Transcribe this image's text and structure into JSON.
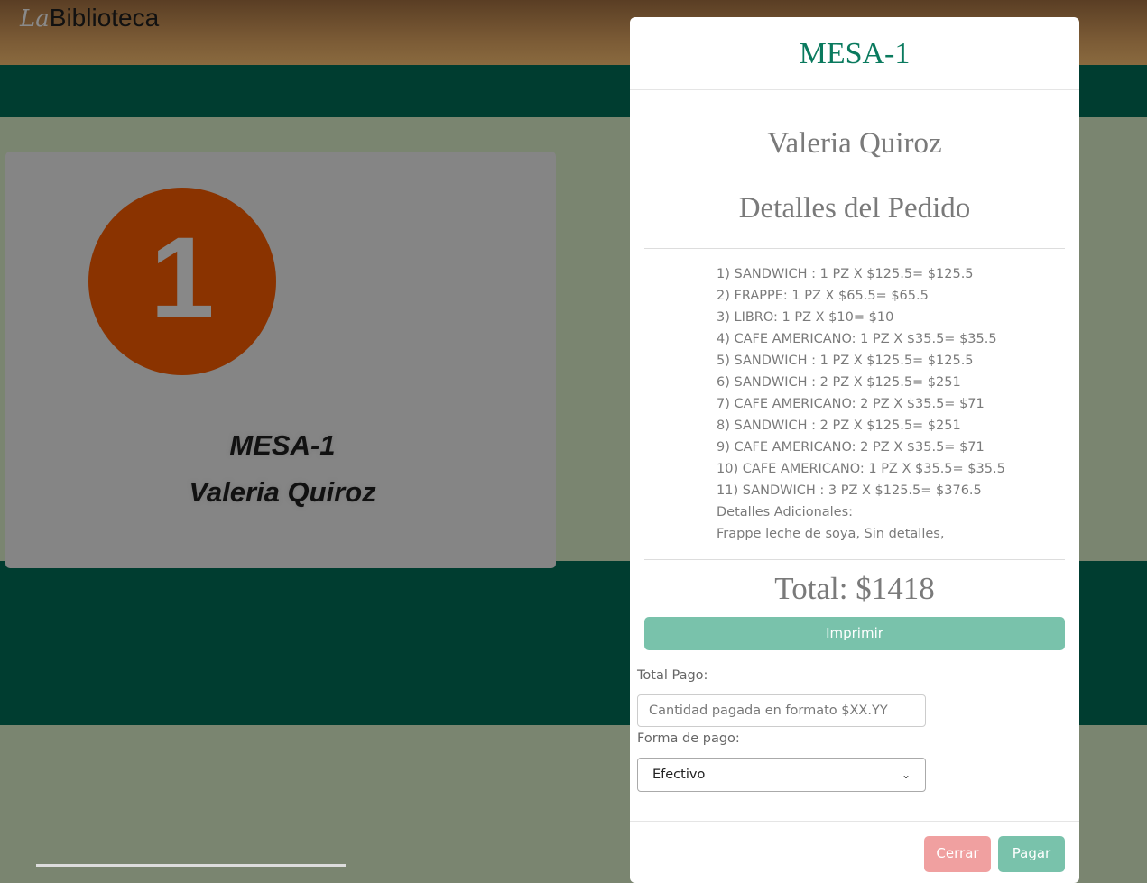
{
  "header": {
    "logo_prefix": "La",
    "logo_main": "Biblioteca"
  },
  "card": {
    "number": "1",
    "title": "MESA-1",
    "client": "Valeria Quiroz"
  },
  "modal": {
    "title": "MESA-1",
    "client": "Valeria Quiroz",
    "details_title": "Detalles del Pedido",
    "items": [
      "1) SANDWICH : 1 PZ X $125.5= $125.5",
      "2) FRAPPE: 1 PZ X $65.5= $65.5",
      "3) LIBRO: 1 PZ X $10= $10",
      "4) CAFE AMERICANO: 1 PZ X $35.5= $35.5",
      "5) SANDWICH : 1 PZ X $125.5= $125.5",
      "6) SANDWICH : 2 PZ X $125.5= $251",
      "7) CAFE AMERICANO: 2 PZ X $35.5= $71",
      "8) SANDWICH : 2 PZ X $125.5= $251",
      "9) CAFE AMERICANO: 2 PZ X $35.5= $71",
      "10) CAFE AMERICANO: 1 PZ X $35.5= $35.5",
      "11) SANDWICH : 3 PZ X $125.5= $376.5"
    ],
    "additional_label": "Detalles Adicionales:",
    "additional_text": "Frappe leche de soya, Sin detalles,",
    "total": "Total: $1418",
    "print_label": "Imprimir",
    "payment_label": "Total Pago:",
    "payment_placeholder": "Cantidad pagada en formato $XX.YY",
    "method_label": "Forma de pago:",
    "method_selected": "Efectivo",
    "close_label": "Cerrar",
    "pay_label": "Pagar"
  }
}
